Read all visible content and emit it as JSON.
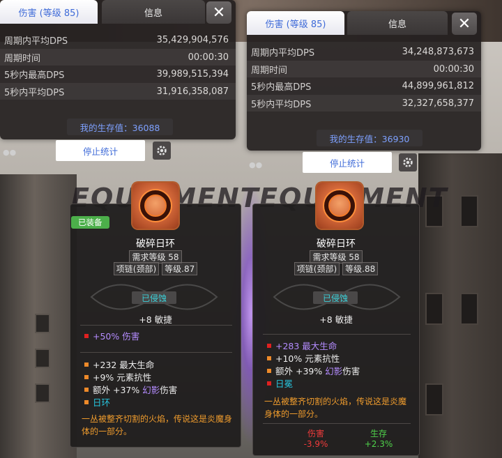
{
  "left_stats": {
    "tab_damage": "伤害 (等级 85)",
    "tab_info": "信息",
    "rows": [
      {
        "label": "周期内平均DPS",
        "value": "35,429,904,576"
      },
      {
        "label": "周期时间",
        "value": "00:00:30"
      },
      {
        "label": "5秒内最高DPS",
        "value": "39,989,515,394"
      },
      {
        "label": "5秒内平均DPS",
        "value": "31,916,358,087"
      }
    ],
    "survival": "我的生存值：36088",
    "stop_label": "停止统计"
  },
  "right_stats": {
    "tab_damage": "伤害 (等级 85)",
    "tab_info": "信息",
    "rows": [
      {
        "label": "周期内平均DPS",
        "value": "34,248,873,673"
      },
      {
        "label": "周期时间",
        "value": "00:00:30"
      },
      {
        "label": "5秒内最高DPS",
        "value": "44,899,961,812"
      },
      {
        "label": "5秒内平均DPS",
        "value": "32,327,658,377"
      }
    ],
    "survival": "我的生存值：36930",
    "stop_label": "停止统计"
  },
  "bg_text": "EQUIPMENT",
  "left_item": {
    "equipped_badge": "已装备",
    "name": "破碎日环",
    "req_level": "需求等级 58",
    "slot": "项链(颈部)",
    "item_level": "等级.87",
    "corrupt": "已侵蚀",
    "main_stat": "+8 敏捷",
    "mod1": "+50% 伤害",
    "mod2": "+232 最大生命",
    "mod3": "+9% 元素抗性",
    "mod4_pre": "额外 +37% ",
    "mod4_hl": "幻影",
    "mod4_post": "伤害",
    "mod5": "日环",
    "flavor": "一丛被整齐切割的火焰，传说这是炎魔身体的一部分。"
  },
  "right_item": {
    "name": "破碎日环",
    "req_level": "需求等级 58",
    "slot": "项链(颈部)",
    "item_level": "等级.88",
    "corrupt": "已侵蚀",
    "main_stat": "+8 敏捷",
    "mod1": "+283 最大生命",
    "mod2": "+10% 元素抗性",
    "mod3_pre": "额外 +39% ",
    "mod3_hl": "幻影",
    "mod3_post": "伤害",
    "mod4": "日冕",
    "flavor": "一丛被整齐切割的火焰，传说这是炎魔身体的一部分。",
    "cmp_damage_label": "伤害",
    "cmp_damage_value": "-3.9%",
    "cmp_survival_label": "生存",
    "cmp_survival_value": "+2.3%"
  },
  "icons": [
    "close-icon",
    "gear-icon",
    "paw-icon",
    "ring-item-icon"
  ]
}
